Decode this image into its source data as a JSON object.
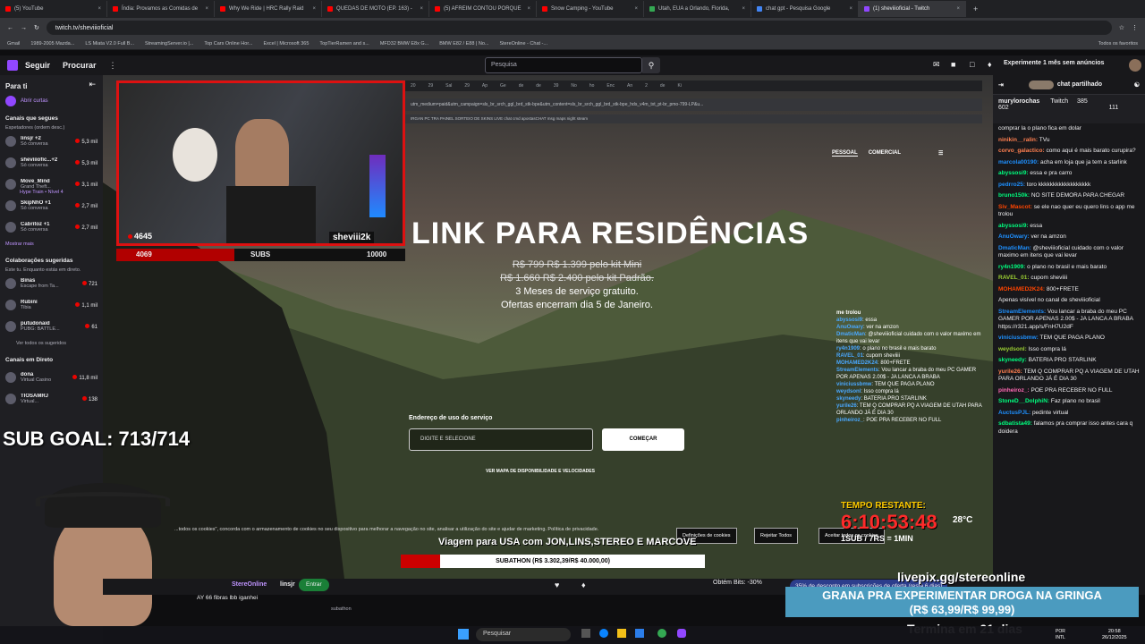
{
  "browser": {
    "tabs": [
      {
        "label": "(5) YouTube",
        "color": "#ff0000"
      },
      {
        "label": "Índia: Provamos as Comidas de",
        "color": "#ff0000"
      },
      {
        "label": "Why We Ride | HRC Rally Raid",
        "color": "#ff0000"
      },
      {
        "label": "QUEDAS DE MOTO (EP. 163) -",
        "color": "#ff0000"
      },
      {
        "label": "(5) AFREIM CONTOU PORQUE",
        "color": "#ff0000"
      },
      {
        "label": "Snow Camping - YouTube",
        "color": "#ff0000"
      },
      {
        "label": "Utah, EUA a Orlando, Florida,",
        "color": "#34a853"
      },
      {
        "label": "chat gpt - Pesquisa Google",
        "color": "#4285f4"
      },
      {
        "label": "(1) sheviiioficial - Twitch",
        "color": "#9147ff"
      }
    ],
    "url": "twitch.tv/sheviiioficial",
    "bookmarks": [
      "Gmail",
      "1989-2005 Mazda...",
      "LS Miata V2.0 Full B...",
      "StreamingServer.io |...",
      "Top Cars Online Hor...",
      "Excel | Microsoft 365",
      "TopTierRamen and s...",
      "MFD32 BMW E8x G...",
      "BMW E82 / E88 | No...",
      "StereOnline - Chat -..."
    ],
    "bookmarks_folder": "Todos os favoritos"
  },
  "twitch": {
    "nav_follow": "Seguir",
    "nav_browse": "Procurar",
    "search_placeholder": "Pesquisa",
    "promo": "Experimente 1 mês sem anúncios"
  },
  "sidebar": {
    "title": "Para ti",
    "clips": "Abrir curtas",
    "followed_title": "Canais que segues",
    "followed_sub": "Espetadores (ordem desc.)",
    "followed": [
      {
        "name": "linsjr +2",
        "game": "Só conversa",
        "count": "5,3 mil"
      },
      {
        "name": "sheviiiofic...+2",
        "game": "Só conversa",
        "count": "5,3 mil"
      },
      {
        "name": "Move_Mind",
        "game": "Grand Theft...",
        "count": "3,1 mil"
      },
      {
        "name": "SkipNhO +1",
        "game": "Só conversa",
        "count": "2,7 mil"
      },
      {
        "name": "Cabritoz +1",
        "game": "Só conversa",
        "count": "2,7 mil"
      }
    ],
    "hype": "Hype Train • Nível 4",
    "more": "Mostrar mais",
    "collab_title": "Colaborações sugeridas",
    "collab_sub": "Este tu. Enquanto estás em direto.",
    "collabs": [
      {
        "name": "Binas",
        "game": "Escape from Ta...",
        "count": "721"
      },
      {
        "name": "Rubini",
        "game": "Tibia",
        "count": "1,1 mil"
      },
      {
        "name": "putudonaid",
        "game": "PUBG: BATTLE...",
        "count": "61"
      }
    ],
    "see_all": "Ver todos os sugeridos",
    "live_title": "Canais em Direto",
    "live": [
      {
        "name": "dona",
        "game": "Virtual Casino",
        "count": "11,8 mil"
      },
      {
        "name": "TIOSAMRJ",
        "game": "Virtual...",
        "count": "138"
      }
    ]
  },
  "stream": {
    "viewers": "4645",
    "streamer_tag": "sheviii2k",
    "sub_left": "4069",
    "sub_label": "SUBS",
    "sub_right": "10000",
    "sub_progress": 0.41,
    "inner_url": "utm_medium=paid&utm_campaign=sls_br_srch_ggl_brd_stk-bpe&utm_content=sls_br_srch_ggl_brd_stk-bpe_hds_v4m_txt_pt-br_pmo-799-LP&u...",
    "inner_bookmarks": "IRGAN  PC  TRA  PAINEL  SORTEIO DE SKINS  LIVE  chat  cmd  apostasCHAT  msg  maps  night  steam",
    "site_nav_1": "PESSOAL",
    "site_nav_2": "COMERCIAL",
    "headline": "LINK PARA RESIDÊNCIAS",
    "price_1": "R$ 799 R$ 1.399 pelo kit Mini",
    "price_2": "R$ 1.660 R$ 2.400 pelo kit Padrão.",
    "offer_1": "3 Meses de serviço gratuito.",
    "offer_2": "Ofertas encerram dia 5 de Janeiro.",
    "addr_label": "Endereço de uso do serviço",
    "addr_placeholder": "DIGITE E SELECIONE",
    "start_btn": "COMEÇAR",
    "avail_link": "VER MAPA DE DISPONIBILIDADE E VELOCIDADES",
    "sub_goal": "SUB GOAL: 713/714",
    "timer_title": "TEMPO RESTANTE:",
    "timer_value": "6:10:53:48",
    "timer_sub": "1SUB / 7RS = 1MIN",
    "temp": "28°C",
    "trip_banner": "Viagem para USA com JON,LINS,STEREO E MARCOVE",
    "subathon": "SUBATHON (R$ 3.302,39/R$ 40.000,00)",
    "subathon_progress": 0.08,
    "cookies_text": "...todos os cookies\", concorda com o armazenamento de cookies no seu dispositivo para melhorar a navegação no site, analisar a utilização do site e ajudar de marketing. Política de privacidade.",
    "cookies_settings": "Definições de cookies",
    "cookies_reject": "Rejeitar Todos",
    "cookies_accept": "Aceitar todos os cookies",
    "livepix": "livepix.gg/stereonline",
    "grana_1": "GRANA PRA EXPERIMENTAR DROGA NA GRINGA",
    "grana_2": "(R$ 63,99/R$ 99,99)",
    "termina": "Termina em 21 dias",
    "overlay_chat": [
      {
        "user": "abyssosi9",
        "text": "essa"
      },
      {
        "user": "AnuOwary",
        "text": "ver na amzon"
      },
      {
        "user": "DmaticMan",
        "text": "@sheviiioficial cuidado com o valor maximo em itens que vai levar"
      },
      {
        "user": "ry4n1909",
        "text": "o plano no brasil e mais barato"
      },
      {
        "user": "RAVEL_01",
        "text": "cupom sheviiii"
      },
      {
        "user": "MOHAMED2K24",
        "text": "800+FRETE"
      },
      {
        "user": "StreamElements",
        "text": "Vou lancar a braba do meu PC GAMER POR APENAS 2.00$ - JA LANCA A BRABA"
      },
      {
        "user": "viniciussbmw",
        "text": "TEM QUE PAGA PLANO"
      },
      {
        "user": "weydsonl",
        "text": "Isso compra lá"
      },
      {
        "user": "skyneedy",
        "text": "BATERIA PRO STARLINK"
      },
      {
        "user": "yurile26",
        "text": "TEM Q COMPRAR PQ A VIAGEM DE UTAH PARA ORLANDO JÁ É DIA 30"
      },
      {
        "user": "pinheiroz_",
        "text": "POE PRA RECEBER NO FULL"
      }
    ]
  },
  "chat": {
    "header": "chat partilhado",
    "pinned_user": "murylorochas",
    "pinned_source": "Twitch",
    "pinned_count_1": "385",
    "pinned_count_2": "111",
    "pinned_sub": "602",
    "messages": [
      {
        "user": "",
        "text": "comprar la o plano fica em dolar",
        "color": "#efeff1"
      },
      {
        "user": "ninikin__ralin:",
        "text": "TVu",
        "color": "#ff7f50"
      },
      {
        "user": "corvo_galactico:",
        "text": "como aqui é mais barato curupira?",
        "color": "#ff7f50"
      },
      {
        "user": "marcola00190:",
        "text": "acha em loja que ja tem a starlink",
        "color": "#1e90ff"
      },
      {
        "user": "abyssosi9:",
        "text": "essa e pra carro",
        "color": "#00ff7f"
      },
      {
        "user": "pedrro25:",
        "text": "toro kkkkkkkkkkkkkkkkkk",
        "color": "#1e90ff"
      },
      {
        "user": "bruno150k:",
        "text": "NO SITE DEMORA PARA CHEGAR",
        "color": "#00ff7f"
      },
      {
        "user": "Siv_Mascot:",
        "text": "se ele nao quer eu quero lins o app me trolou",
        "color": "#ff4500"
      },
      {
        "user": "abyssosi9:",
        "text": "essa",
        "color": "#00ff7f"
      },
      {
        "user": "AnuOwary:",
        "text": "ver na amzon",
        "color": "#1e90ff"
      },
      {
        "user": "DmaticMan:",
        "text": "@sheviiioficial cuidado com o valor maximo em itens que vai levar",
        "color": "#1e90ff"
      },
      {
        "user": "ry4n1909:",
        "text": "o plano no brasil e mais barato",
        "color": "#00ff7f"
      },
      {
        "user": "RAVEL_01:",
        "text": "cupom sheviiii",
        "color": "#9acd32"
      },
      {
        "user": "MOHAMED2K24:",
        "text": "800+FRETE",
        "color": "#ff4500"
      },
      {
        "user": "",
        "text": "Apenas visível no canal de sheviiioficial",
        "color": "#adadb8"
      },
      {
        "user": "StreamElements:",
        "text": "Vou lancar a braba do meu PC GAMER POR APENAS 2.00$ - JA LANCA A BRABA https://r321.app/s/FnH7U2dF",
        "color": "#1e90ff"
      },
      {
        "user": "viniciussbmw:",
        "text": "TEM QUE PAGA PLANO",
        "color": "#1e90ff"
      },
      {
        "user": "weydsonl:",
        "text": "Isso compra lá",
        "color": "#9acd32"
      },
      {
        "user": "skyneedy:",
        "text": "BATERIA PRO STARLINK",
        "color": "#00ff7f"
      },
      {
        "user": "yurile26:",
        "text": "TEM Q COMPRAR PQ A VIAGEM DE UTAH PARA ORLANDO JÁ É DIA 30",
        "color": "#ff7f50"
      },
      {
        "user": "pinheiroz_:",
        "text": "POE PRA RECEBER NO FULL",
        "color": "#ff69b4"
      },
      {
        "user": "StoneD__DolphiN:",
        "text": "Faz plano no brasil",
        "color": "#00ff7f"
      },
      {
        "user": "AuctusPJL:",
        "text": "pedinte virtual",
        "color": "#1e90ff"
      },
      {
        "user": "sdbatista49:",
        "text": "falamos pra comprar isso antes cara q doidera",
        "color": "#00ff7f"
      }
    ]
  },
  "bottom": {
    "entrar": "Entrar",
    "stereonline": "StereOnline",
    "linsjr": "linsjr",
    "bits": "Obtém Bits: -30%",
    "discount": "35% de desconto em subscrições de oferta (resta 6 dias)",
    "ticker": "AY 66 fibras lbb iganhei",
    "tag": "subathon"
  },
  "taskbar": {
    "search": "Pesquisar",
    "lang_1": "POR",
    "lang_2": "INTL",
    "time": "20:58",
    "date": "26/12/2025"
  }
}
